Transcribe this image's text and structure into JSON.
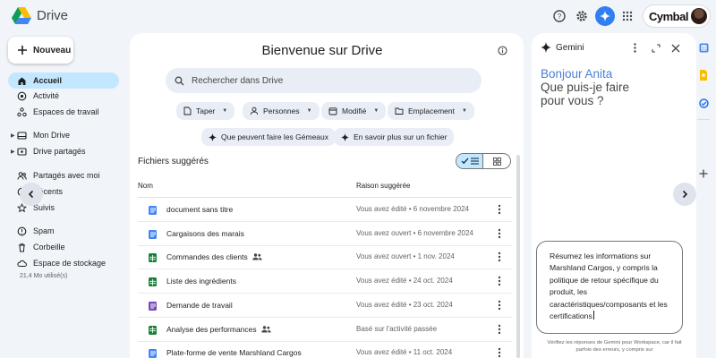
{
  "app": {
    "title": "Drive",
    "brand": "Cymbal"
  },
  "sidebar": {
    "new_label": "Nouveau",
    "items": [
      {
        "label": "Accueil",
        "icon": "home-icon",
        "active": true
      },
      {
        "label": "Activité",
        "icon": "activity-icon"
      },
      {
        "label": "Espaces de travail",
        "icon": "workspaces-icon"
      },
      {
        "label": "Mon Drive",
        "icon": "my-drive-icon"
      },
      {
        "label": "Drive partagés",
        "icon": "shared-drives-icon"
      },
      {
        "label": "Partagés avec moi",
        "icon": "shared-with-me-icon"
      },
      {
        "label": "Récents",
        "icon": "recent-icon"
      },
      {
        "label": "Suivis",
        "icon": "star-icon"
      },
      {
        "label": "Spam",
        "icon": "spam-icon"
      },
      {
        "label": "Corbeille",
        "icon": "trash-icon"
      },
      {
        "label": "Espace de stockage",
        "icon": "cloud-icon"
      }
    ],
    "storage_used": "21,4 Mo utilisé(s)"
  },
  "main": {
    "welcome": "Bienvenue sur Drive",
    "search_placeholder": "Rechercher dans Drive",
    "filters": [
      "Taper",
      "Personnes",
      "Modifié",
      "Emplacement"
    ],
    "suggestions": [
      "Que peuvent faire les Gémeaux",
      "En savoir plus sur un fichier"
    ],
    "suggested_title": "Fichiers suggérés",
    "columns": {
      "name": "Nom",
      "reason": "Raison suggérée"
    },
    "files": [
      {
        "name": "document sans titre",
        "type": "doc",
        "shared": false,
        "reason": "Vous avez édité • 6 novembre 2024"
      },
      {
        "name": "Cargaisons des marais",
        "type": "doc",
        "shared": false,
        "reason": "Vous avez ouvert • 6 novembre 2024"
      },
      {
        "name": "Commandes des clients",
        "type": "sheet",
        "shared": true,
        "reason": "Vous avez ouvert • 1 nov. 2024"
      },
      {
        "name": "Liste des ingrédients",
        "type": "sheet",
        "shared": false,
        "reason": "Vous avez édité • 24 oct. 2024"
      },
      {
        "name": "Demande de travail",
        "type": "form",
        "shared": false,
        "reason": "Vous avez édité • 23 oct. 2024"
      },
      {
        "name": "Analyse des performances",
        "type": "sheet",
        "shared": true,
        "reason": "Basé sur l'activité passée"
      },
      {
        "name": "Plate-forme de vente Marshland Cargos",
        "type": "doc",
        "shared": false,
        "reason": "Vous avez édité • 11 oct. 2024"
      }
    ]
  },
  "gemini": {
    "title": "Gemini",
    "greeting": [
      "Bonjour Anita",
      "Que puis-je faire",
      "pour vous ?"
    ],
    "prompt": "Résumez les informations sur Marshland Cargos, y compris la politique de retour spécifique du produit, les caractéristiques/composants et les certifications",
    "disclaimer": "Vérifiez les réponses de Gemini pour Workspace, car il fait parfois des erreurs, y compris sur"
  },
  "colors": {
    "accent": "#0b57d0",
    "active_bg": "#c2e7ff",
    "doc": "#4285f4",
    "sheet": "#188038",
    "form": "#7248b9"
  }
}
